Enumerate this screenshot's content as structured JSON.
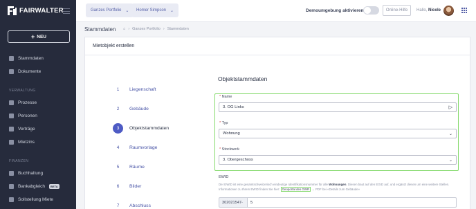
{
  "sidebar": {
    "logo_text": "FAIRWALTER",
    "new_button": "NEU",
    "items_top": [
      {
        "label": "Stammdaten",
        "icon": "building-icon"
      },
      {
        "label": "Dokumente",
        "icon": "document-icon"
      }
    ],
    "section_verwaltung": "VERWALTUNG",
    "items_verwaltung": [
      {
        "label": "Prozesse",
        "icon": "process-icon"
      },
      {
        "label": "Personen",
        "icon": "people-icon"
      },
      {
        "label": "Verträge",
        "icon": "contract-icon"
      },
      {
        "label": "Mietzins",
        "icon": "rent-icon"
      }
    ],
    "section_finanzen": "FINANZEN",
    "items_finanzen": [
      {
        "label": "Buchhaltung",
        "icon": "ledger-icon"
      },
      {
        "label": "Bankabgleich",
        "icon": "bank-icon",
        "badge": "BETA"
      },
      {
        "label": "Sollstellung Miete",
        "icon": "invoice-icon"
      }
    ]
  },
  "topbar": {
    "portfolio_dropdown": "Ganzes Portfolio",
    "person_dropdown": "Homer Simpson",
    "demo_label": "Demoumgebung aktivieren",
    "help_button": "Online-Hilfe",
    "greeting_prefix": "Hallo,",
    "greeting_name": "Nicole"
  },
  "breadcrumb": {
    "page_title": "Stammdaten",
    "path": [
      "Ganzes Portfolio",
      "Stammdaten"
    ]
  },
  "card": {
    "title": "Mietobjekt erstellen",
    "steps": [
      {
        "num": "1",
        "label": "Liegenschaft"
      },
      {
        "num": "2",
        "label": "Gebäude"
      },
      {
        "num": "3",
        "label": "Objektstammdaten"
      },
      {
        "num": "4",
        "label": "Raumvorlage"
      },
      {
        "num": "5",
        "label": "Räume"
      },
      {
        "num": "6",
        "label": "Bilder"
      },
      {
        "num": "7",
        "label": "Abschluss"
      }
    ],
    "active_step": 3
  },
  "form": {
    "section_title": "Objektstammdaten",
    "name_label": "Name",
    "name_value": "3. OG Links",
    "type_label": "Typ",
    "type_value": "Wohnung",
    "floor_label": "Stockwerk",
    "floor_value": "3. Obergeschoss",
    "ewid_label": "EWID",
    "ewid_help_1": "Der EWID ist eine gesamtschweizerisch eindeutige Identifikationsnummer für alle",
    "ewid_help_bold": "Wohnungen",
    "ewid_help_2": ". Diesen baut auf den EGID auf, und ergänzt diesen um eine weitere Stellen. Informationen zu Ihrem EWID finden Sie hier:",
    "ewid_link": "Geoportal des GWR",
    "ewid_help_3": "→ PDF bei «Details zum Gebäude»",
    "ewid_prefix": "302021547-",
    "ewid_value": "5"
  },
  "colors": {
    "sidebar_bg": "#262b3c",
    "accent": "#4e5bc4",
    "highlight": "#83d96a"
  }
}
